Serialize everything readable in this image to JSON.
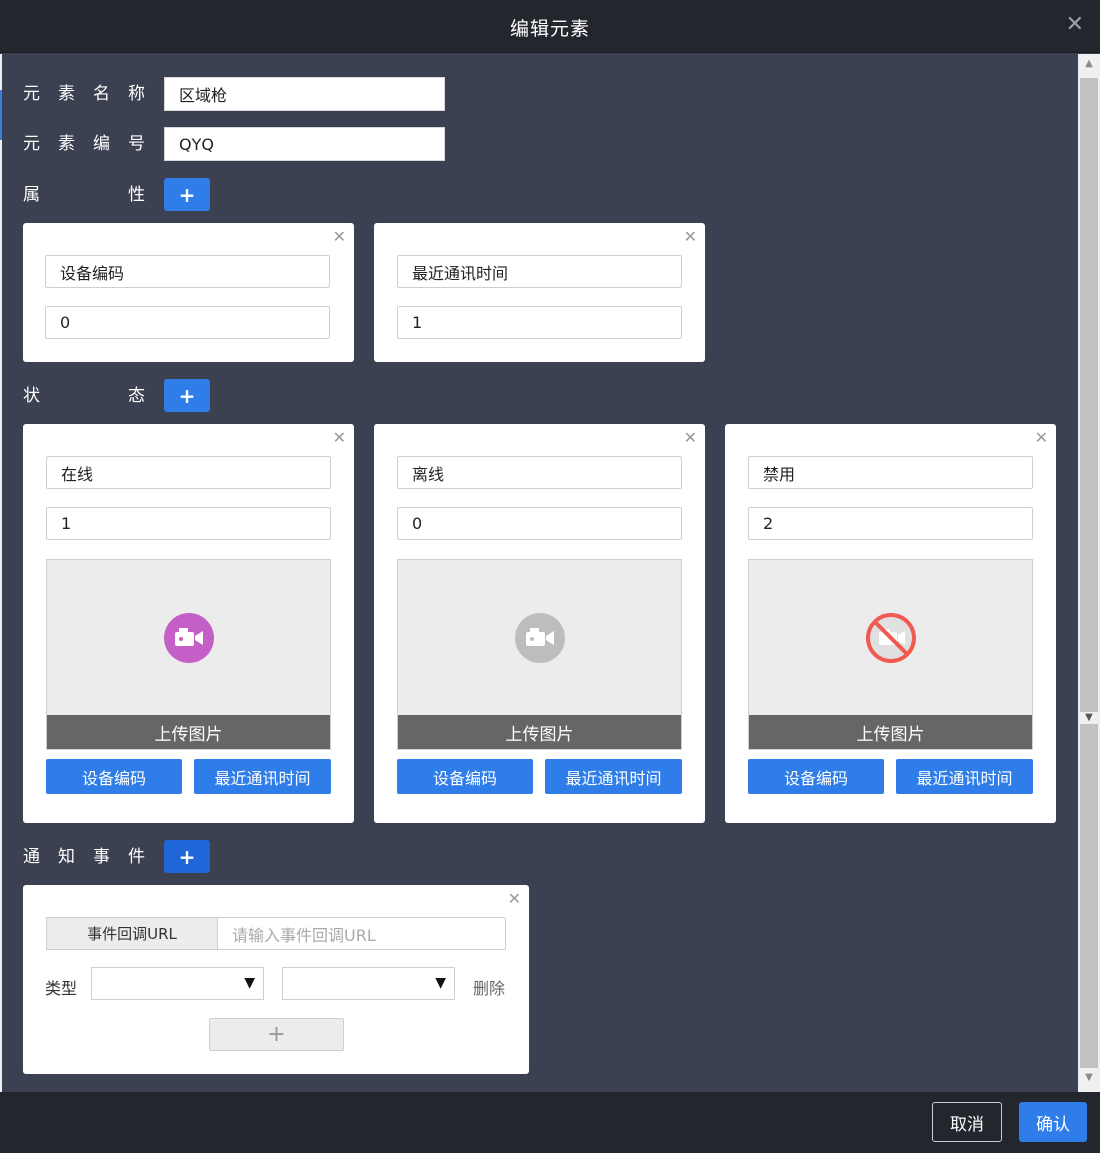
{
  "dialog": {
    "title": "编辑元素",
    "close_icon": "close-icon"
  },
  "form": {
    "name_label": [
      "元",
      "素",
      "名",
      "称"
    ],
    "name_value": "区域枪",
    "code_label": [
      "元",
      "素",
      "编",
      "号"
    ],
    "code_value": "QYQ",
    "attr_label": [
      "属",
      "性"
    ],
    "state_label": [
      "状",
      "态"
    ],
    "event_label": [
      "通",
      "知",
      "事",
      "件"
    ],
    "add_label": "+"
  },
  "attributes": [
    {
      "key": "设备编码",
      "value": "0"
    },
    {
      "key": "最近通讯时间",
      "value": "1"
    }
  ],
  "states": [
    {
      "name": "在线",
      "value": "1",
      "icon": "camera-icon",
      "icon_color": "#c35fc6",
      "upload_label": "上传图片",
      "btn1": "设备编码",
      "btn2": "最近通讯时间"
    },
    {
      "name": "离线",
      "value": "0",
      "icon": "camera-icon",
      "icon_color": "#bdbdbd",
      "upload_label": "上传图片",
      "btn1": "设备编码",
      "btn2": "最近通讯时间"
    },
    {
      "name": "禁用",
      "value": "2",
      "icon": "camera-disabled-icon",
      "icon_color": "#f05a50",
      "upload_label": "上传图片",
      "btn1": "设备编码",
      "btn2": "最近通讯时间"
    }
  ],
  "event": {
    "url_addon": "事件回调URL",
    "url_placeholder": "请输入事件回调URL",
    "type_label": "类型",
    "delete_label": "删除",
    "add_label": "+"
  },
  "footer": {
    "cancel": "取消",
    "ok": "确认"
  },
  "colors": {
    "accent": "#2f7de8",
    "background": "#3b4150",
    "header": "#24262e"
  }
}
